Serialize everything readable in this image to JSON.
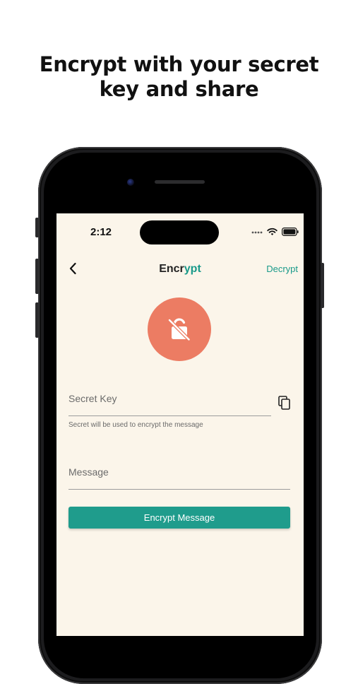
{
  "headline": {
    "line1": "Encrypt with your secret",
    "line2": "key and share"
  },
  "status_bar": {
    "time": "2:12"
  },
  "nav": {
    "title_part1": "Encr",
    "title_part2": "ypt",
    "right_action": "Decrypt"
  },
  "form": {
    "secret_key_label": "Secret Key",
    "secret_key_helper": "Secret will be used to encrypt the message",
    "message_label": "Message",
    "submit_label": "Encrypt Message"
  },
  "colors": {
    "accent": "#1a9a8a",
    "button": "#1f9c8c",
    "lock_circle": "#ec7c63",
    "screen_background": "#fbf5ea"
  },
  "icons": [
    "back-chevron-icon",
    "lock-off-icon",
    "copy-icon",
    "signal-icon",
    "wifi-icon",
    "battery-icon"
  ]
}
